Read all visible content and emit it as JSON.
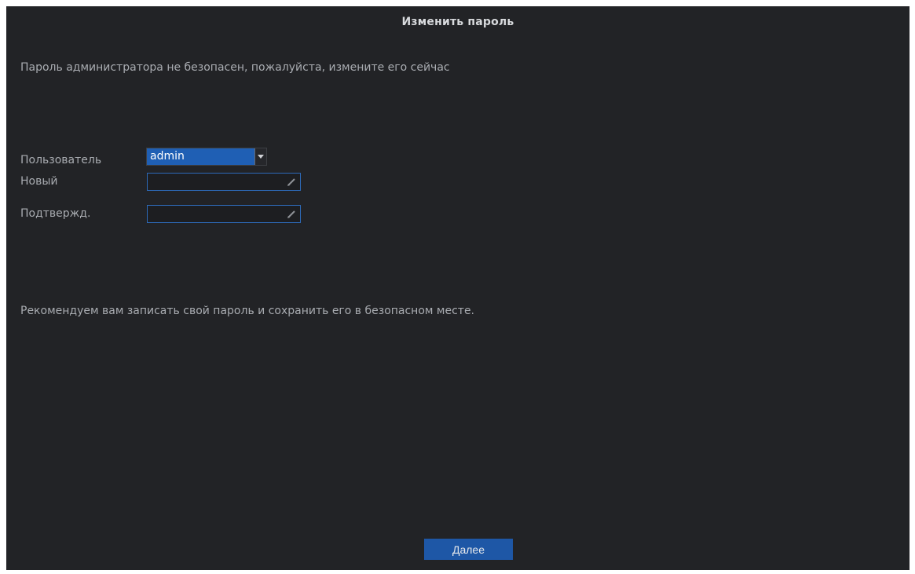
{
  "dialog": {
    "title": "Изменить пароль",
    "warning": "Пароль администратора не безопасен, пожалуйста, измените его сейчас",
    "note": "Рекомендуем вам записать свой пароль и сохранить его в безопасном месте.",
    "next_label": "Далее"
  },
  "form": {
    "user_label": "Пользователь",
    "user_value": "admin",
    "new_label": "Новый",
    "new_value": "",
    "confirm_label": "Подтвержд.",
    "confirm_value": ""
  },
  "icons": {
    "select_arrow": "chevron-down-icon",
    "edit": "pencil-icon"
  },
  "colors": {
    "background": "#222326",
    "accent": "#1f5fb4",
    "button": "#1e57a6",
    "field_border": "#2d6ab9"
  }
}
